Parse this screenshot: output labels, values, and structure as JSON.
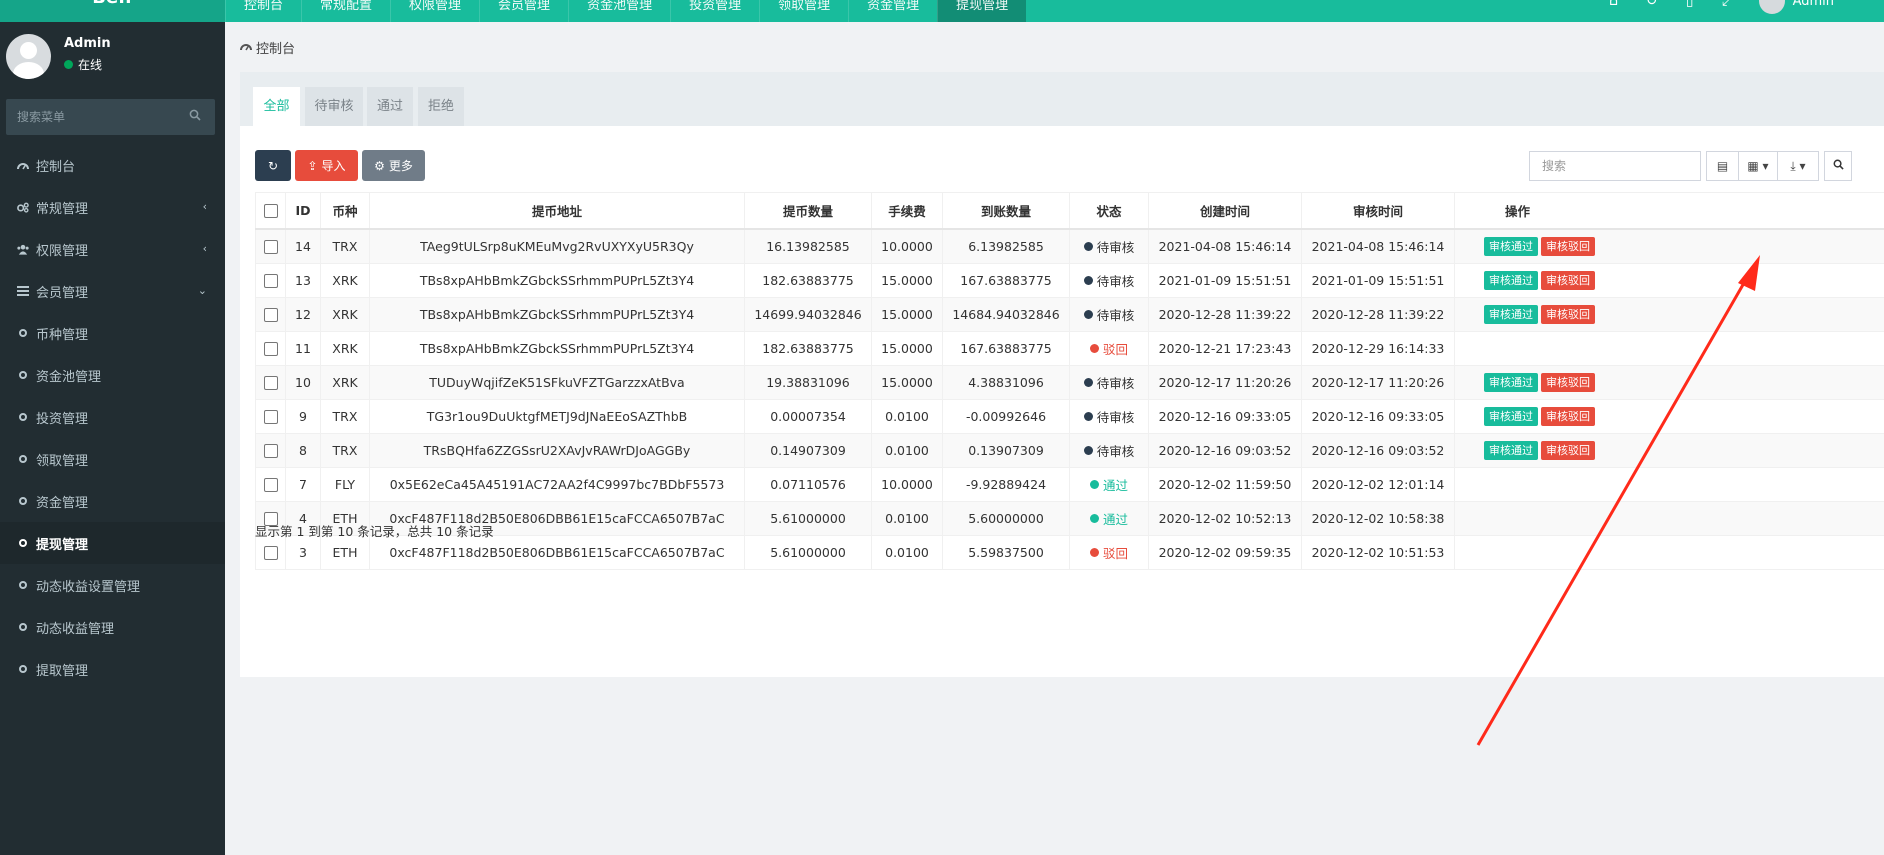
{
  "topbar": {
    "logo": "Beff",
    "nav": [
      "控制台",
      "常规配置",
      "权限管理",
      "会员管理",
      "资金池管理",
      "投资管理",
      "领取管理",
      "资金管理",
      "提现管理"
    ],
    "active_index": 8,
    "user_name": "Admin"
  },
  "sidebar": {
    "user": {
      "name": "Admin",
      "status": "在线"
    },
    "search_placeholder": "搜索菜单",
    "items": [
      {
        "label": "控制台",
        "icon": "dashboard-icon",
        "chevron": ""
      },
      {
        "label": "常规管理",
        "icon": "cogs-icon",
        "chevron": "‹"
      },
      {
        "label": "权限管理",
        "icon": "users-icon",
        "chevron": "‹"
      },
      {
        "label": "会员管理",
        "icon": "list-icon",
        "chevron": "⌄"
      },
      {
        "label": "币种管理",
        "icon": "circle-icon",
        "chevron": ""
      },
      {
        "label": "资金池管理",
        "icon": "circle-icon",
        "chevron": ""
      },
      {
        "label": "投资管理",
        "icon": "circle-icon",
        "chevron": ""
      },
      {
        "label": "领取管理",
        "icon": "circle-icon",
        "chevron": ""
      },
      {
        "label": "资金管理",
        "icon": "circle-icon",
        "chevron": ""
      },
      {
        "label": "提现管理",
        "icon": "circle-icon",
        "chevron": "",
        "active": true
      },
      {
        "label": "动态收益设置管理",
        "icon": "circle-icon",
        "chevron": ""
      },
      {
        "label": "动态收益管理",
        "icon": "circle-icon",
        "chevron": ""
      },
      {
        "label": "提取管理",
        "icon": "circle-icon",
        "chevron": ""
      }
    ]
  },
  "breadcrumb": "控制台",
  "tabs": [
    "全部",
    "待审核",
    "通过",
    "拒绝"
  ],
  "toolbar": {
    "import_label": "导入",
    "more_label": "更多"
  },
  "search": {
    "placeholder": "搜索"
  },
  "table": {
    "headers": [
      "",
      "ID",
      "币种",
      "提币地址",
      "提币数量",
      "手续费",
      "到账数量",
      "状态",
      "创建时间",
      "审核时间",
      "操作"
    ],
    "action_labels": {
      "approve": "审核通过",
      "reject": "审核驳回"
    },
    "rows": [
      {
        "id": "14",
        "coin": "TRX",
        "address": "TAeg9tULSrp8uKMEuMvg2RvUXYXyU5R3Qy",
        "amount": "16.13982585",
        "fee": "10.0000",
        "received": "6.13982585",
        "status": "待审核",
        "status_type": "pending",
        "created": "2021-04-08 15:46:14",
        "reviewed": "2021-04-08 15:46:14",
        "actions": true
      },
      {
        "id": "13",
        "coin": "XRK",
        "address": "TBs8xpAHbBmkZGbckSSrhmmPUPrL5Zt3Y4",
        "amount": "182.63883775",
        "fee": "15.0000",
        "received": "167.63883775",
        "status": "待审核",
        "status_type": "pending",
        "created": "2021-01-09 15:51:51",
        "reviewed": "2021-01-09 15:51:51",
        "actions": true
      },
      {
        "id": "12",
        "coin": "XRK",
        "address": "TBs8xpAHbBmkZGbckSSrhmmPUPrL5Zt3Y4",
        "amount": "14699.94032846",
        "fee": "15.0000",
        "received": "14684.94032846",
        "status": "待审核",
        "status_type": "pending",
        "created": "2020-12-28 11:39:22",
        "reviewed": "2020-12-28 11:39:22",
        "actions": true
      },
      {
        "id": "11",
        "coin": "XRK",
        "address": "TBs8xpAHbBmkZGbckSSrhmmPUPrL5Zt3Y4",
        "amount": "182.63883775",
        "fee": "15.0000",
        "received": "167.63883775",
        "status": "驳回",
        "status_type": "rejected",
        "created": "2020-12-21 17:23:43",
        "reviewed": "2020-12-29 16:14:33",
        "actions": false
      },
      {
        "id": "10",
        "coin": "XRK",
        "address": "TUDuyWqjifZeK51SFkuVFZTGarzzxAtBva",
        "amount": "19.38831096",
        "fee": "15.0000",
        "received": "4.38831096",
        "status": "待审核",
        "status_type": "pending",
        "created": "2020-12-17 11:20:26",
        "reviewed": "2020-12-17 11:20:26",
        "actions": true
      },
      {
        "id": "9",
        "coin": "TRX",
        "address": "TG3r1ou9DuUktgfMETJ9dJNaEEoSAZThbB",
        "amount": "0.00007354",
        "fee": "0.0100",
        "received": "-0.00992646",
        "status": "待审核",
        "status_type": "pending",
        "created": "2020-12-16 09:33:05",
        "reviewed": "2020-12-16 09:33:05",
        "actions": true
      },
      {
        "id": "8",
        "coin": "TRX",
        "address": "TRsBQHfa6ZZGSsrU2XAvJvRAWrDJoAGGBy",
        "amount": "0.14907309",
        "fee": "0.0100",
        "received": "0.13907309",
        "status": "待审核",
        "status_type": "pending",
        "created": "2020-12-16 09:03:52",
        "reviewed": "2020-12-16 09:03:52",
        "actions": true
      },
      {
        "id": "7",
        "coin": "FLY",
        "address": "0x5E62eCa45A45191AC72AA2f4C9997bc7BDbF5573",
        "amount": "0.07110576",
        "fee": "10.0000",
        "received": "-9.92889424",
        "status": "通过",
        "status_type": "passed",
        "created": "2020-12-02 11:59:50",
        "reviewed": "2020-12-02 12:01:14",
        "actions": false
      },
      {
        "id": "4",
        "coin": "ETH",
        "address": "0xcF487F118d2B50E806DBB61E15caFCCA6507B7aC",
        "amount": "5.61000000",
        "fee": "0.0100",
        "received": "5.60000000",
        "status": "通过",
        "status_type": "passed",
        "created": "2020-12-02 10:52:13",
        "reviewed": "2020-12-02 10:58:38",
        "actions": false
      },
      {
        "id": "3",
        "coin": "ETH",
        "address": "0xcF487F118d2B50E806DBB61E15caFCCA6507B7aC",
        "amount": "5.61000000",
        "fee": "0.0100",
        "received": "5.59837500",
        "status": "驳回",
        "status_type": "rejected",
        "created": "2020-12-02 09:59:35",
        "reviewed": "2020-12-02 10:51:53",
        "actions": false
      }
    ]
  },
  "pagination_info": "显示第 1 到第 10 条记录，总共 10 条记录",
  "colors": {
    "primary": "#18bc9c",
    "danger": "#e74c3c",
    "sidebar": "#222d32",
    "annotation": "#ff2a1a"
  }
}
